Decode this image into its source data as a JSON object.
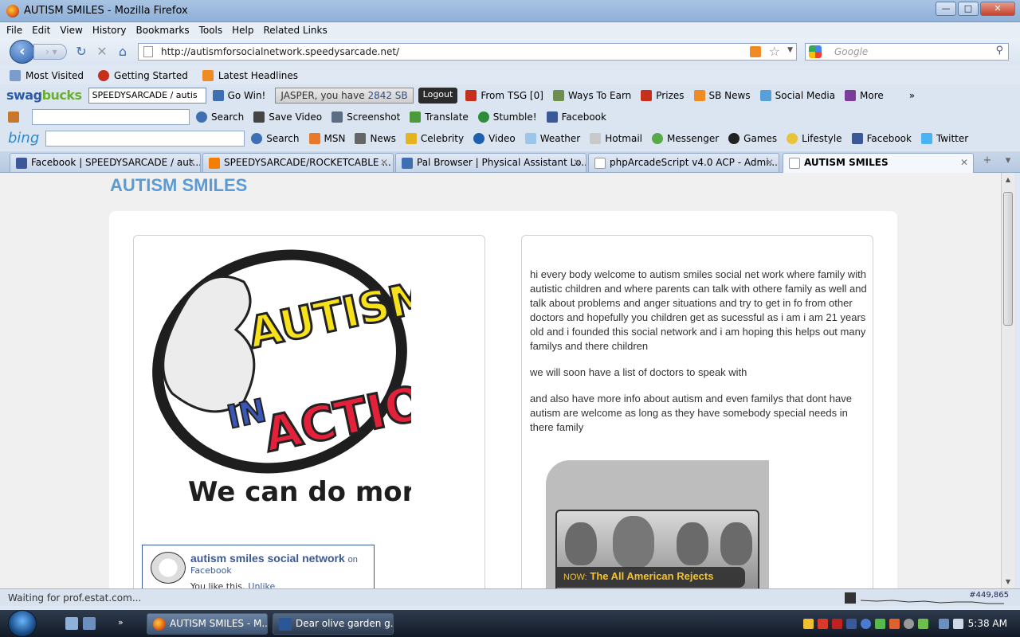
{
  "window": {
    "title": "AUTISM SMILES - Mozilla Firefox"
  },
  "menu": [
    "File",
    "Edit",
    "View",
    "History",
    "Bookmarks",
    "Tools",
    "Help",
    "Related Links"
  ],
  "nav": {
    "url": "http://autismforsocialnetwork.speedysarcade.net/",
    "search_placeholder": "Google"
  },
  "bookmarks": [
    "Most Visited",
    "Getting Started",
    "Latest Headlines"
  ],
  "swagbucks": {
    "logo_a": "swag",
    "logo_b": "bucks",
    "select_value": "SPEEDYSARCADE / autis",
    "go_win": "Go Win!",
    "message_prefix": "JASPER, you have",
    "message_count": "2842 SB",
    "logout": "Logout",
    "from_tsg": "From TSG [0]",
    "ways_to_earn": "Ways To Earn",
    "prizes": "Prizes",
    "sb_news": "SB News",
    "social_media": "Social Media",
    "more": "More",
    "overflow": "»"
  },
  "toolbar2": {
    "search": "Search",
    "save_video": "Save Video",
    "screenshot": "Screenshot",
    "translate": "Translate",
    "stumble": "Stumble!",
    "facebook": "Facebook"
  },
  "bing": {
    "logo": "bing",
    "search": "Search",
    "links": [
      "MSN",
      "News",
      "Celebrity",
      "Video",
      "Weather",
      "Hotmail",
      "Messenger",
      "Games",
      "Lifestyle",
      "Facebook",
      "Twitter"
    ]
  },
  "tabs": [
    {
      "label": "Facebook | SPEEDYSARCADE / aut...",
      "color": "#3b5998"
    },
    {
      "label": "SPEEDYSARCADE/ROCKETCABLE ...",
      "color": "#f57d00"
    },
    {
      "label": "Pal Browser | Physical Assistant Lo...",
      "color": "#3d6fb2"
    },
    {
      "label": "phpArcadeScript v4.0 ACP - Admi...",
      "color": "#ffffff"
    },
    {
      "label": "AUTISM SMILES",
      "color": "#ffffff"
    }
  ],
  "page": {
    "site_title": "AUTISM SMILES",
    "logo": {
      "line1": "AUTISM",
      "line2": "IN",
      "line3": "ACTION",
      "tagline": "We can do more!"
    },
    "fb": {
      "name": "autism smiles social network",
      "on": "on",
      "source": "Facebook",
      "liked": "You like this.",
      "unlike": "Unlike"
    },
    "paragraphs": [
      "hi every body welcome to autism smiles social net work where family with autistic children and where parents can talk with othere family as well and talk about problems and anger situations and try to get in fo from other doctors and hopefully you children get as sucessful as i am i am 21 years old and i founded this social network and i am hoping this helps out many familys and there children",
      "we will soon have a list of doctors to speak with",
      "and also have more info about autism and even familys that dont have autism are welcome as long as they have somebody special needs in there family"
    ],
    "media": {
      "now_label": "NOW:",
      "now_title": "The All American Rejects"
    }
  },
  "status": {
    "text": "Waiting for prof.estat.com...",
    "rank": "#449,865"
  },
  "taskbar": {
    "tasks": [
      "AUTISM SMILES - M...",
      "Dear olive garden g..."
    ],
    "clock": "5:38 AM"
  },
  "colors": {
    "accent": "#5b9bd5",
    "facebook": "#3b5998",
    "now_yellow": "#f6c22b"
  }
}
